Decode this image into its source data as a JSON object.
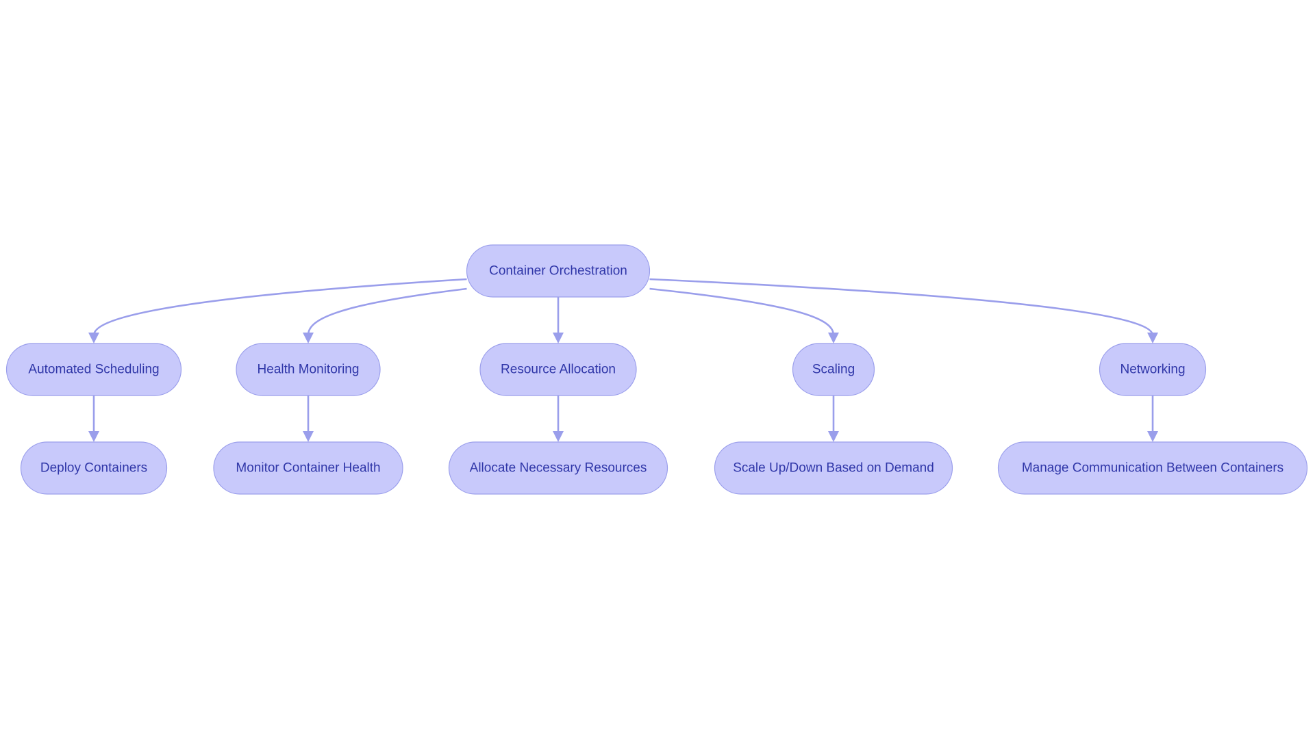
{
  "diagram": {
    "type": "flowchart",
    "direction": "top-down",
    "colors": {
      "node_fill": "#C8C9FB",
      "node_stroke": "#9A9EEB",
      "node_text": "#2F36A8",
      "edge": "#9A9EEB",
      "background": "#FFFFFF"
    },
    "nodes": [
      {
        "id": "root",
        "label": "Container Orchestration"
      },
      {
        "id": "sched",
        "label": "Automated Scheduling"
      },
      {
        "id": "health",
        "label": "Health Monitoring"
      },
      {
        "id": "resource",
        "label": "Resource Allocation"
      },
      {
        "id": "scaling",
        "label": "Scaling"
      },
      {
        "id": "network",
        "label": "Networking"
      },
      {
        "id": "deploy",
        "label": "Deploy Containers"
      },
      {
        "id": "monitor",
        "label": "Monitor Container Health"
      },
      {
        "id": "allocate",
        "label": "Allocate Necessary Resources"
      },
      {
        "id": "scaleupdown",
        "label": "Scale Up/Down Based on Demand"
      },
      {
        "id": "comm",
        "label": "Manage Communication Between Containers"
      }
    ],
    "edges": [
      {
        "from": "root",
        "to": "sched"
      },
      {
        "from": "root",
        "to": "health"
      },
      {
        "from": "root",
        "to": "resource"
      },
      {
        "from": "root",
        "to": "scaling"
      },
      {
        "from": "root",
        "to": "network"
      },
      {
        "from": "sched",
        "to": "deploy"
      },
      {
        "from": "health",
        "to": "monitor"
      },
      {
        "from": "resource",
        "to": "allocate"
      },
      {
        "from": "scaling",
        "to": "scaleupdown"
      },
      {
        "from": "network",
        "to": "comm"
      }
    ]
  }
}
